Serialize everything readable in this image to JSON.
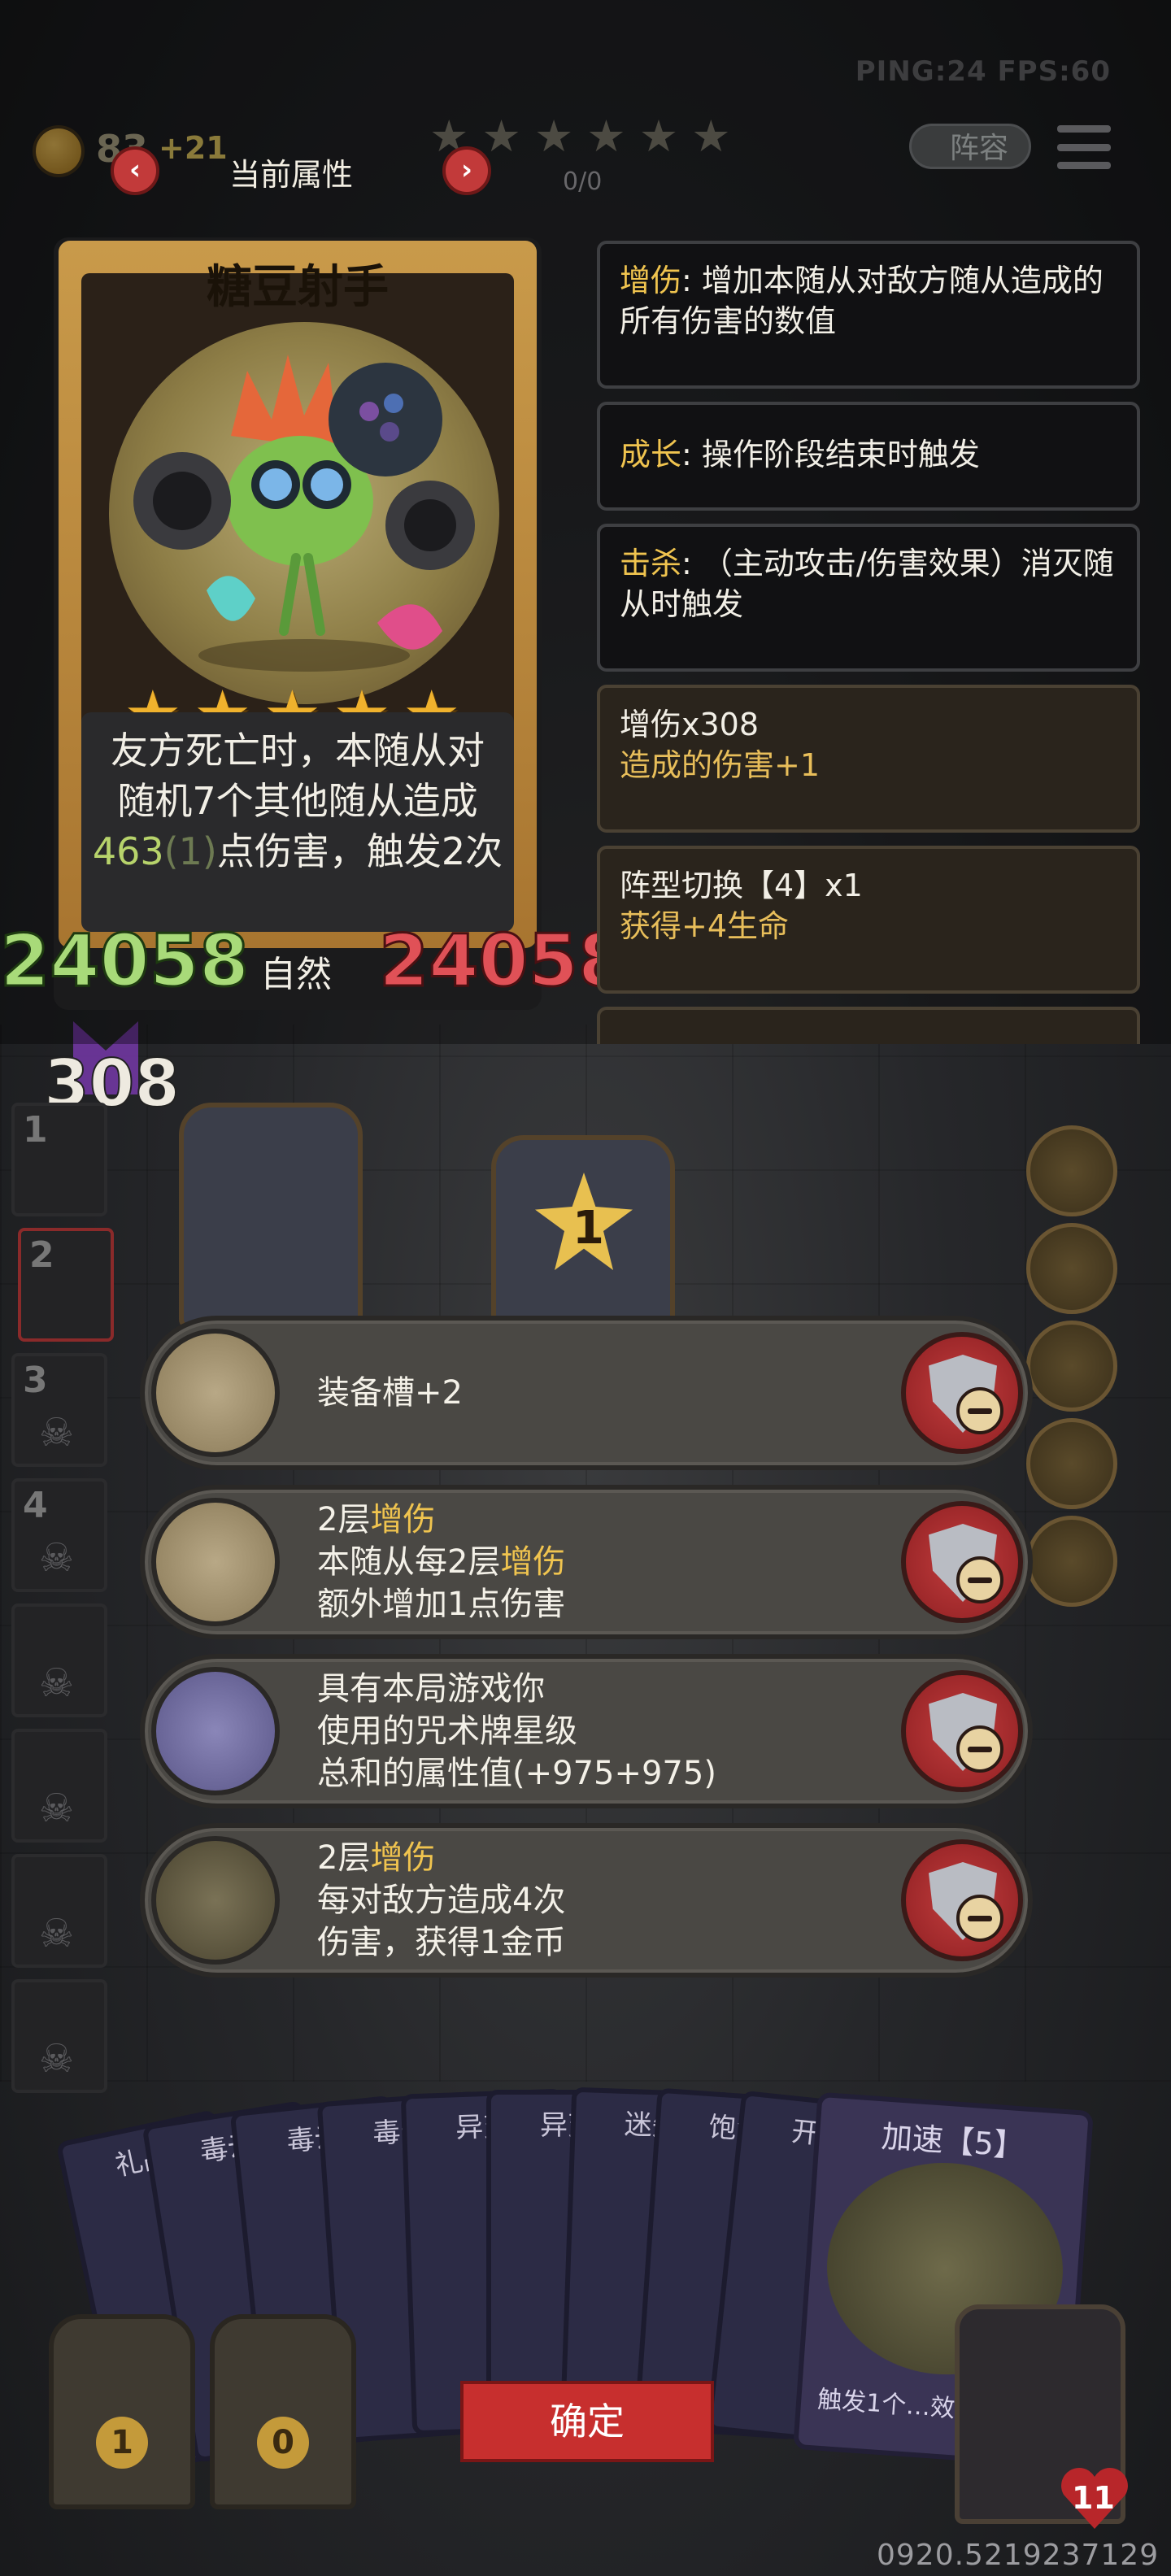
{
  "hud": {
    "ping_fps": "PING:24  FPS:60",
    "gold": "83",
    "gold_plus": "+21",
    "progress": "0/0",
    "lineup_button": "阵容",
    "attr_title": "当前属性",
    "prev_arrow": "‹",
    "next_arrow": "›"
  },
  "card": {
    "name": "糖豆射手",
    "stars": [
      "★",
      "★",
      "★",
      "★",
      "★"
    ],
    "desc_line1": "友方死亡时，本随从对",
    "desc_line2": "随机7个其他随从造成",
    "desc_num": "463",
    "desc_num2": "(1)",
    "desc_line3": "点伤害，触发2次",
    "attack": "24058",
    "type": "自然",
    "health": "24058"
  },
  "info_panel": [
    {
      "kw": "增伤",
      "text": ": 增加本随从对敌方随从造成的所有伤害的数值"
    },
    {
      "kw": "成长",
      "text": ": 操作阶段结束时触发"
    },
    {
      "kw": "击杀",
      "text": ": （主动攻击/伤害效果）消灭随从时触发"
    }
  ],
  "buffs": [
    {
      "title": "增伤x308",
      "sub": "造成的伤害+1"
    },
    {
      "title": "阵型切换【4】x1",
      "sub": "获得+4生命"
    }
  ],
  "board": {
    "kill_count": "308",
    "slots": [
      "1",
      "2",
      "3",
      "4",
      "",
      "",
      "",
      ""
    ],
    "enemy_level": "1"
  },
  "equipment": [
    {
      "line1": "装备槽+2",
      "kw1": "",
      "line2": "",
      "kw2": "",
      "line2b": "",
      "line3": ""
    },
    {
      "line1": "2层",
      "kw1": "增伤",
      "line2": "本随从每2层",
      "kw2": "增伤",
      "line2b": "",
      "line3": "额外增加1点伤害"
    },
    {
      "line1": "具有本局游戏你",
      "kw1": "",
      "line2": "使用的咒术牌星级",
      "kw2": "",
      "line2b": "",
      "line3": "总和的属性值(+975+975)"
    },
    {
      "line1": "2层",
      "kw1": "增伤",
      "line2": "每对敌方造成4次",
      "kw2": "",
      "line2b": "",
      "line3": "伤害，获得1金币"
    }
  ],
  "hand": {
    "cards": [
      "礼品",
      "毒云",
      "毒云",
      "毒云",
      "异变",
      "异变",
      "迷失",
      "饱食",
      "开胃"
    ],
    "big_card_title": "加速【5】",
    "big_card_text": "触发1个…效果。"
  },
  "bottom": {
    "chest_left": "1",
    "chest_right": "0",
    "confirm": "确定",
    "hero_hp": "11",
    "coords": "0920.5219237129"
  },
  "colors": {
    "keyword": "#f0c44f",
    "attack": "#a8da79",
    "health": "#e05157",
    "confirm": "#c72f2e"
  }
}
